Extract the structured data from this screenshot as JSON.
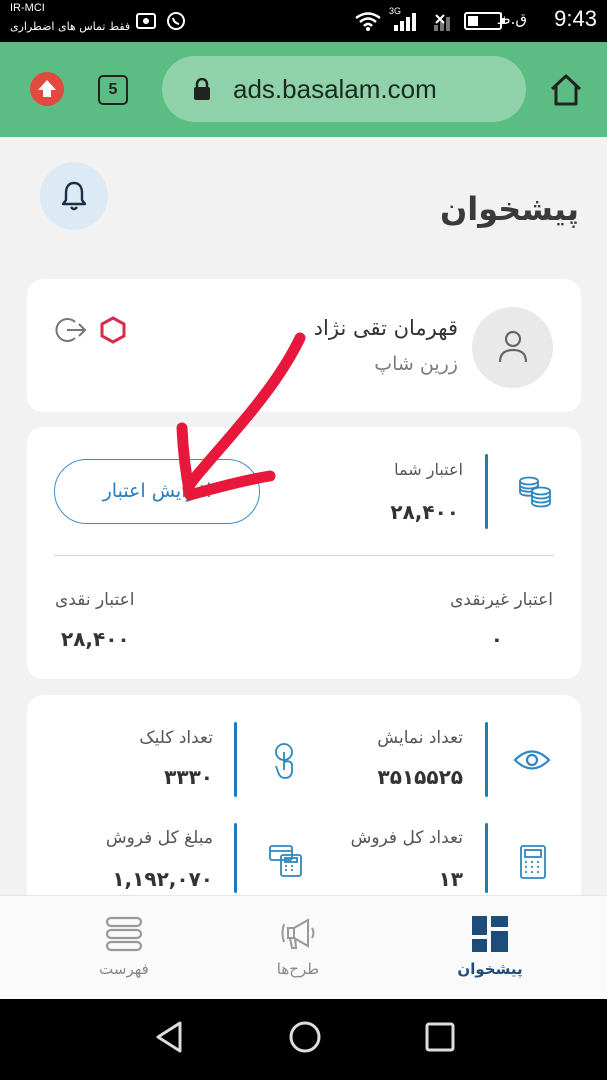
{
  "status_bar": {
    "carrier": "IR-MCI",
    "emergency": "فقط تماس های اضطراری",
    "time": "9:43",
    "ampm": "ق.ظ",
    "network": "3G"
  },
  "browser": {
    "url": "ads.basalam.com",
    "tab_count": "5"
  },
  "page": {
    "title": "پیشخوان"
  },
  "profile": {
    "name": "قهرمان تقی نژاد",
    "shop": "زرین شاپ"
  },
  "credit": {
    "label": "اعتبار شما",
    "value": "۲۸,۴۰۰",
    "charge_button": "افزایش اعتبار",
    "noncash_label": "اعتبار غیرنقدی",
    "noncash_value": "۰",
    "cash_label": "اعتبار نقدی",
    "cash_value": "۲۸,۴۰۰"
  },
  "stats": {
    "impressions_label": "تعداد نمایش",
    "impressions_value": "۳۵۱۵۵۲۵",
    "clicks_label": "تعداد کلیک",
    "clicks_value": "۳۳۳۰",
    "sales_count_label": "تعداد کل فروش",
    "sales_count_value": "۱۳",
    "sales_amount_label": "مبلغ کل فروش",
    "sales_amount_value": "۱,۱۹۲,۰۷۰"
  },
  "bottom_nav": {
    "dashboard": "پیشخوان",
    "plans": "طرح‌ها",
    "list": "فهرست"
  },
  "colors": {
    "browser_bar": "#5cbd84",
    "accent_blue": "#1e7ab8",
    "nav_active": "#1f4d7a",
    "annotation_red": "#e8173c"
  }
}
